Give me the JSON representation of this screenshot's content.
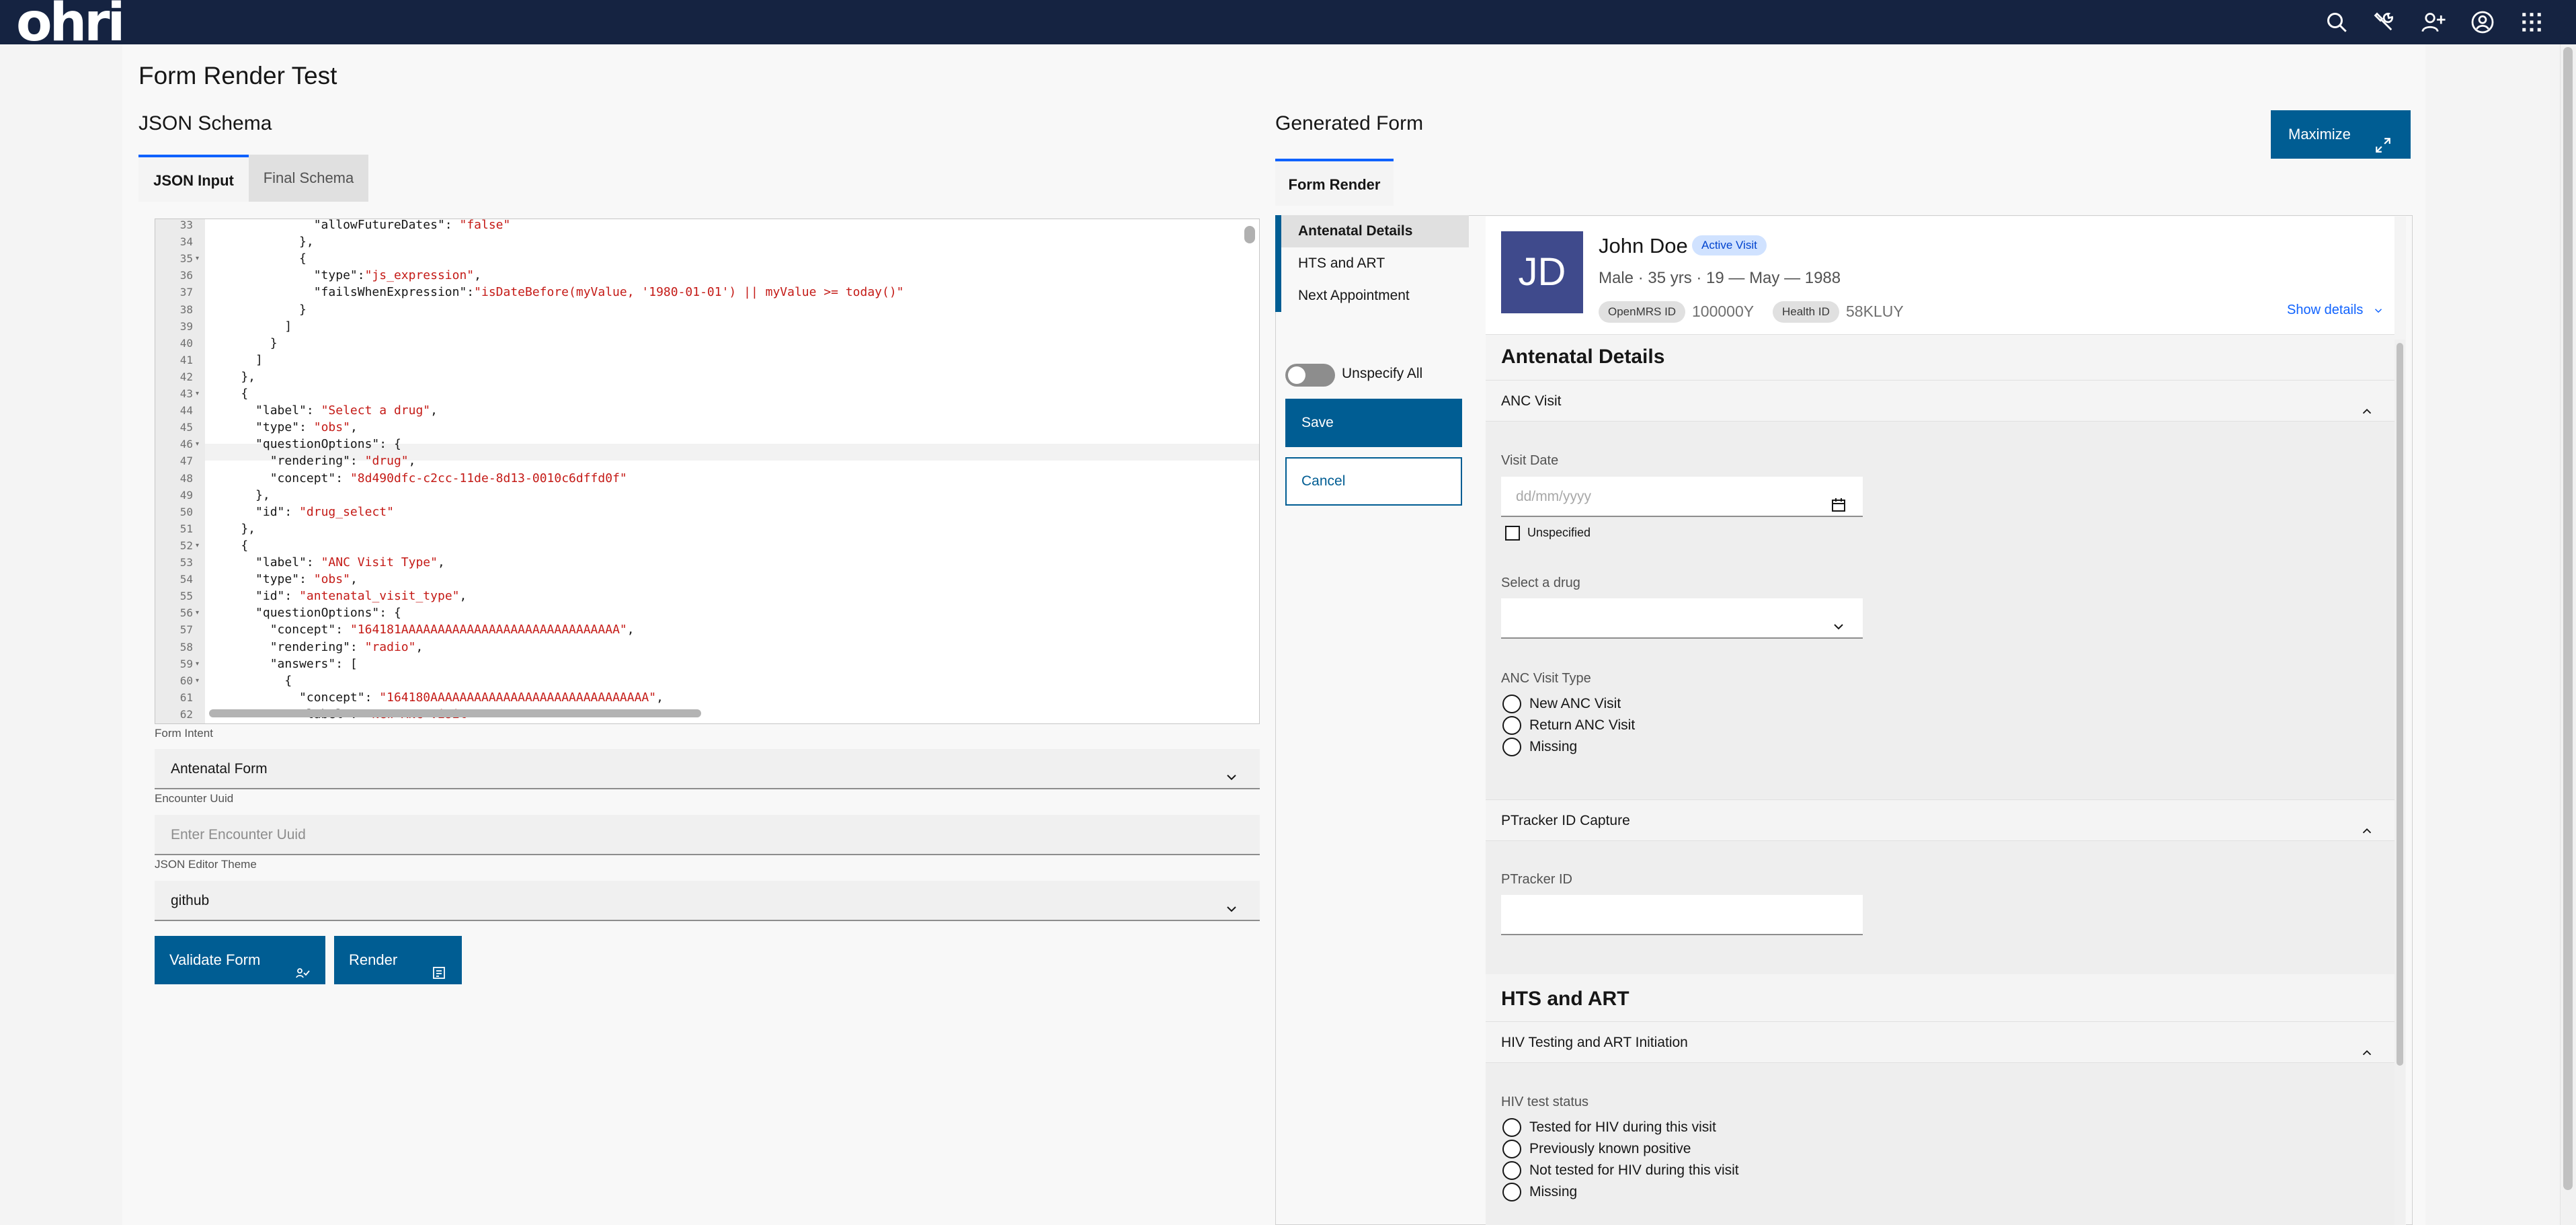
{
  "header": {
    "logo_text": "ohri",
    "icons": [
      "search-icon",
      "tools-icon",
      "add-user-icon",
      "user-profile-icon",
      "app-switcher-icon"
    ]
  },
  "page": {
    "title": "Form Render Test",
    "json_schema_title": "JSON Schema",
    "generated_form_title": "Generated Form",
    "tabs": [
      "JSON Input",
      "Final Schema"
    ],
    "right_tab": "Form Render",
    "maximize_label": "Maximize"
  },
  "editor": {
    "lines": [
      {
        "n": "33",
        "fold": false,
        "text": "              \"allowFutureDates\": \"false\""
      },
      {
        "n": "34",
        "fold": false,
        "text": "            },"
      },
      {
        "n": "35",
        "fold": true,
        "text": "            {"
      },
      {
        "n": "36",
        "fold": false,
        "text": "              \"type\":\"js_expression\","
      },
      {
        "n": "37",
        "fold": false,
        "text": "              \"failsWhenExpression\":\"isDateBefore(myValue, '1980-01-01') || myValue >= today()\""
      },
      {
        "n": "38",
        "fold": false,
        "text": "            }"
      },
      {
        "n": "39",
        "fold": false,
        "text": "          ]"
      },
      {
        "n": "40",
        "fold": false,
        "text": "        }"
      },
      {
        "n": "41",
        "fold": false,
        "text": "      ]"
      },
      {
        "n": "42",
        "fold": false,
        "text": "    },"
      },
      {
        "n": "43",
        "fold": true,
        "text": "    {"
      },
      {
        "n": "44",
        "fold": false,
        "text": "      \"label\": \"Select a drug\","
      },
      {
        "n": "45",
        "fold": false,
        "text": "      \"type\": \"obs\","
      },
      {
        "n": "46",
        "fold": true,
        "text": "      \"questionOptions\": {"
      },
      {
        "n": "47",
        "fold": false,
        "text": "        \"rendering\": \"drug\","
      },
      {
        "n": "48",
        "fold": false,
        "text": "        \"concept\": \"8d490dfc-c2cc-11de-8d13-0010c6dffd0f\""
      },
      {
        "n": "49",
        "fold": false,
        "text": "      },"
      },
      {
        "n": "50",
        "fold": false,
        "text": "      \"id\": \"drug_select\""
      },
      {
        "n": "51",
        "fold": false,
        "text": "    },"
      },
      {
        "n": "52",
        "fold": true,
        "text": "    {"
      },
      {
        "n": "53",
        "fold": false,
        "text": "      \"label\": \"ANC Visit Type\","
      },
      {
        "n": "54",
        "fold": false,
        "text": "      \"type\": \"obs\","
      },
      {
        "n": "55",
        "fold": false,
        "text": "      \"id\": \"antenatal_visit_type\","
      },
      {
        "n": "56",
        "fold": true,
        "text": "      \"questionOptions\": {"
      },
      {
        "n": "57",
        "fold": false,
        "text": "        \"concept\": \"164181AAAAAAAAAAAAAAAAAAAAAAAAAAAAAA\","
      },
      {
        "n": "58",
        "fold": false,
        "text": "        \"rendering\": \"radio\","
      },
      {
        "n": "59",
        "fold": true,
        "text": "        \"answers\": ["
      },
      {
        "n": "60",
        "fold": true,
        "text": "          {"
      },
      {
        "n": "61",
        "fold": false,
        "text": "            \"concept\": \"164180AAAAAAAAAAAAAAAAAAAAAAAAAAAAAA\","
      },
      {
        "n": "62",
        "fold": false,
        "text": "            \"label\": \"New ANC Visit\""
      }
    ]
  },
  "form_settings": {
    "intent_label": "Form Intent",
    "intent_value": "Antenatal Form",
    "encounter_label": "Encounter Uuid",
    "encounter_placeholder": "Enter Encounter Uuid",
    "theme_label": "JSON Editor Theme",
    "theme_value": "github",
    "validate_label": "Validate Form",
    "render_label": "Render"
  },
  "form_nav": {
    "items": [
      "Antenatal Details",
      "HTS and ART",
      "Next Appointment"
    ],
    "unspecify_all": "Unspecify All",
    "save": "Save",
    "cancel": "Cancel"
  },
  "patient": {
    "initials": "JD",
    "name": "John Doe",
    "visit_badge": "Active Visit",
    "demographics": "Male · 35 yrs · 19 — May — 1988",
    "openmrs_id_label": "OpenMRS ID",
    "openmrs_id": "100000Y",
    "health_id_label": "Health ID",
    "health_id": "58KLUY",
    "show_details": "Show details"
  },
  "form": {
    "section1_title": "Antenatal Details",
    "anc_visit_header": "ANC Visit",
    "visit_date_label": "Visit Date",
    "visit_date_placeholder": "dd/mm/yyyy",
    "unspecified_label": "Unspecified",
    "drug_label": "Select a drug",
    "anc_type_label": "ANC Visit Type",
    "anc_type_options": [
      "New ANC Visit",
      "Return ANC Visit",
      "Missing"
    ],
    "ptracker_header": "PTracker ID Capture",
    "ptracker_label": "PTracker ID",
    "section2_title": "HTS and ART",
    "hiv_header": "HIV Testing and ART Initiation",
    "hiv_status_label": "HIV test status",
    "hiv_status_options": [
      "Tested for HIV during this visit",
      "Previously known positive",
      "Not tested for HIV during this visit",
      "Missing"
    ]
  },
  "colors": {
    "header_bg": "#152341",
    "primary": "#005d93",
    "link": "#0f62fe",
    "string_literal": "#c41a16"
  }
}
